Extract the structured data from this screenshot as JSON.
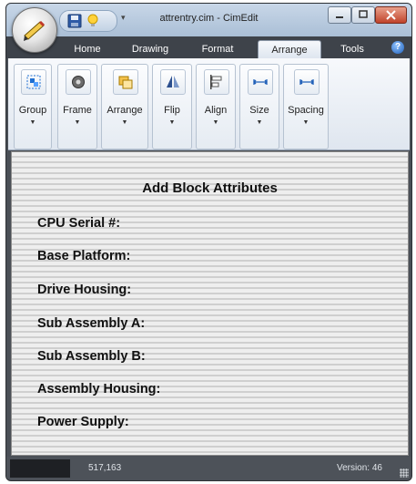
{
  "window": {
    "title": "attrentry.cim - CimEdit"
  },
  "ribbon_tabs": [
    "Home",
    "Drawing",
    "Format",
    "Arrange",
    "Tools"
  ],
  "active_tab": "Arrange",
  "ribbon_groups": [
    {
      "label": "Group",
      "icon": "group-icon"
    },
    {
      "label": "Frame",
      "icon": "frame-icon"
    },
    {
      "label": "Arrange",
      "icon": "arrange-icon"
    },
    {
      "label": "Flip",
      "icon": "flip-icon"
    },
    {
      "label": "Align",
      "icon": "align-icon"
    },
    {
      "label": "Size",
      "icon": "size-icon"
    },
    {
      "label": "Spacing",
      "icon": "spacing-icon"
    }
  ],
  "document": {
    "title": "Add Block Attributes",
    "fields": [
      "CPU Serial #:",
      "Base Platform:",
      "Drive Housing:",
      "Sub Assembly A:",
      "Sub Assembly B:",
      "Assembly Housing:",
      "Power Supply:"
    ]
  },
  "status": {
    "coordinates": "517,163",
    "version": "Version: 46"
  },
  "colors": {
    "accent_blue": "#1f5fb8",
    "close_red": "#c0432a"
  }
}
